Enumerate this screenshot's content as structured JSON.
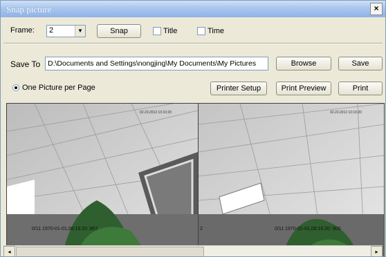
{
  "window": {
    "title": "Snap picture",
    "close_glyph": "×"
  },
  "frame": {
    "label": "Frame:",
    "value": "2",
    "snap_label": "Snap"
  },
  "options": {
    "title_label": "Title",
    "time_label": "Time"
  },
  "save": {
    "label": "Save To",
    "path": "D:\\Documents and Settings\\nongjing\\My Documents\\My Pictures",
    "browse_label": "Browse",
    "save_label": "Save"
  },
  "print": {
    "radio_label": "One Picture per Page",
    "printer_setup_label": "Printer Setup",
    "print_preview_label": "Print Preview",
    "print_label": "Print"
  },
  "images": [
    {
      "caption": "0/11   1970-01-01,08:16:20 :857",
      "overlay": "02.23.2012 10:10:20"
    },
    {
      "caption_left": "2",
      "caption": "0/11   1970-01-01,08:16:20 :900",
      "overlay": "02.23.2012 10:10:20"
    }
  ],
  "scrollbar": {
    "left_glyph": "◂",
    "right_glyph": "▸"
  }
}
